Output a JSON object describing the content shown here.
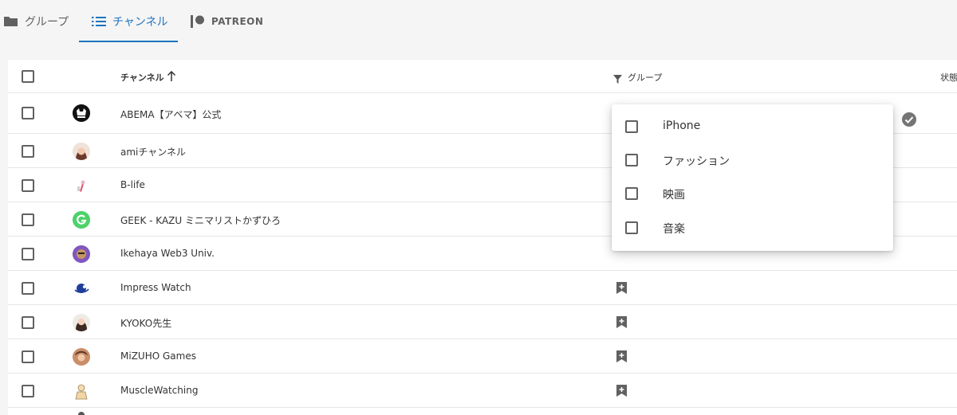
{
  "tabs": [
    {
      "label": "グループ",
      "icon": "folder-icon",
      "active": false
    },
    {
      "label": "チャンネル",
      "icon": "list-icon",
      "active": true
    },
    {
      "label": "PATREON",
      "icon": "patreon-icon",
      "active": false
    }
  ],
  "table": {
    "columns": {
      "channel": "チャンネル",
      "group": "グループ",
      "status": "状態"
    },
    "sort_icon": "arrow-up-icon",
    "filter_icon": "filter-icon",
    "rows": [
      {
        "name": "ABEMA【アベマ】公式",
        "avatar": "abema"
      },
      {
        "name": "amiチャンネル",
        "avatar": "ami"
      },
      {
        "name": "B-life",
        "avatar": "blife"
      },
      {
        "name": "GEEK - KAZU ミニマリストかずひろ",
        "avatar": "geek"
      },
      {
        "name": "Ikehaya Web3 Univ.",
        "avatar": "ikehaya"
      },
      {
        "name": "Impress Watch",
        "avatar": "impress"
      },
      {
        "name": "KYOKO先生",
        "avatar": "kyoko"
      },
      {
        "name": "MiZUHO Games",
        "avatar": "mizuho"
      },
      {
        "name": "MuscleWatching",
        "avatar": "muscle"
      }
    ]
  },
  "group_dropdown": {
    "options": [
      "iPhone",
      "ファッション",
      "映画",
      "音楽"
    ]
  },
  "colors": {
    "accent": "#1e73be",
    "icon_gray": "#616161"
  }
}
